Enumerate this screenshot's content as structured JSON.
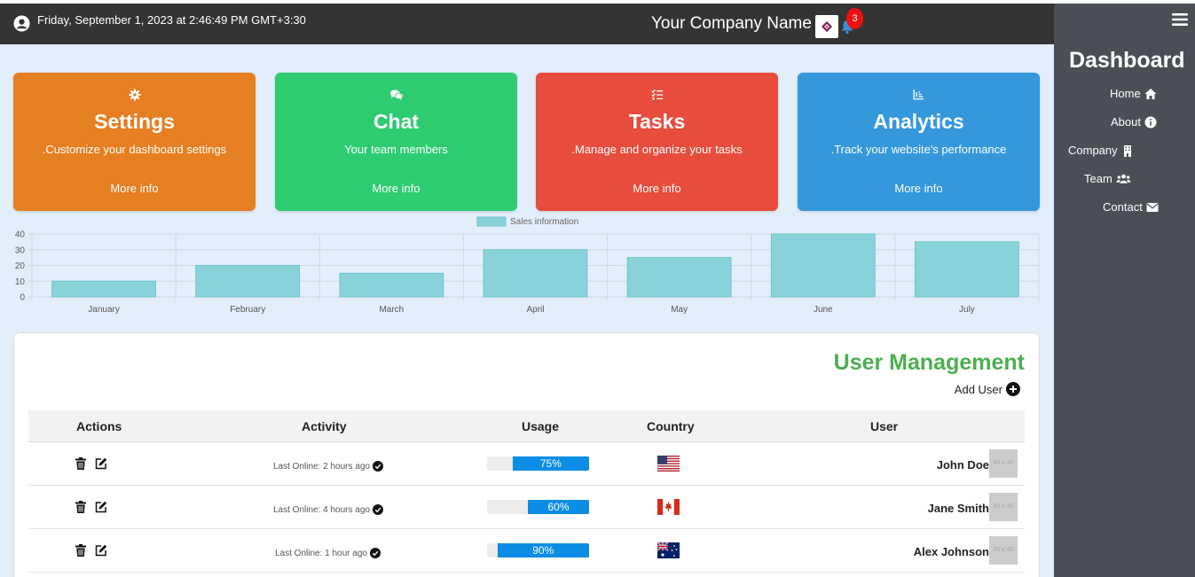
{
  "header": {
    "datetime": "Friday, September 1, 2023 at 2:46:49 PM GMT+3:30",
    "company_name": "Your Company Name",
    "notification_count": "3"
  },
  "cards": [
    {
      "title": "Settings",
      "description": ".Customize your dashboard settings",
      "more": "More info",
      "color": "#e67e22",
      "icon": "gear-icon"
    },
    {
      "title": "Chat",
      "description": "Your team members",
      "more": "More info",
      "color": "#2ecc71",
      "icon": "chat-icon"
    },
    {
      "title": "Tasks",
      "description": ".Manage and organize your tasks",
      "more": "More info",
      "color": "#e74c3c",
      "icon": "tasks-icon"
    },
    {
      "title": "Analytics",
      "description": ".Track your website's performance",
      "more": "More info",
      "color": "#3498db",
      "icon": "chart-icon"
    }
  ],
  "chart_data": {
    "type": "bar",
    "categories": [
      "January",
      "February",
      "March",
      "April",
      "May",
      "June",
      "July"
    ],
    "series": [
      {
        "name": "Sales information",
        "values": [
          10,
          20,
          15,
          30,
          25,
          40,
          35
        ]
      }
    ],
    "yticks": [
      0,
      10,
      20,
      30,
      40
    ],
    "ylim": [
      0,
      40
    ],
    "grid": true,
    "legend": "top-center",
    "bar_color": "#88d3d9",
    "bar_border": "#6cc4ca"
  },
  "user_management": {
    "title": "User Management",
    "add_user": "Add User",
    "columns": {
      "actions": "Actions",
      "activity": "Activity",
      "usage": "Usage",
      "country": "Country",
      "user": "User"
    },
    "rows": [
      {
        "activity": "Last Online: 2 hours ago",
        "usage": 75,
        "usage_label": "75%",
        "country": "us",
        "name": "John Doe",
        "avatar": "40 x 40"
      },
      {
        "activity": "Last Online: 4 hours ago",
        "usage": 60,
        "usage_label": "60%",
        "country": "ca",
        "name": "Jane Smith",
        "avatar": "40 x 40"
      },
      {
        "activity": "Last Online: 1 hour ago",
        "usage": 90,
        "usage_label": "90%",
        "country": "au",
        "name": "Alex Johnson",
        "avatar": "40 x 40"
      }
    ]
  },
  "sidebar": {
    "title": "Dashboard",
    "items": [
      {
        "label": "Home",
        "icon": "home-icon"
      },
      {
        "label": "About",
        "icon": "info-icon"
      },
      {
        "label": "Company",
        "icon": "building-icon"
      },
      {
        "label": "Team",
        "icon": "users-icon"
      },
      {
        "label": "Contact",
        "icon": "envelope-icon"
      }
    ]
  }
}
